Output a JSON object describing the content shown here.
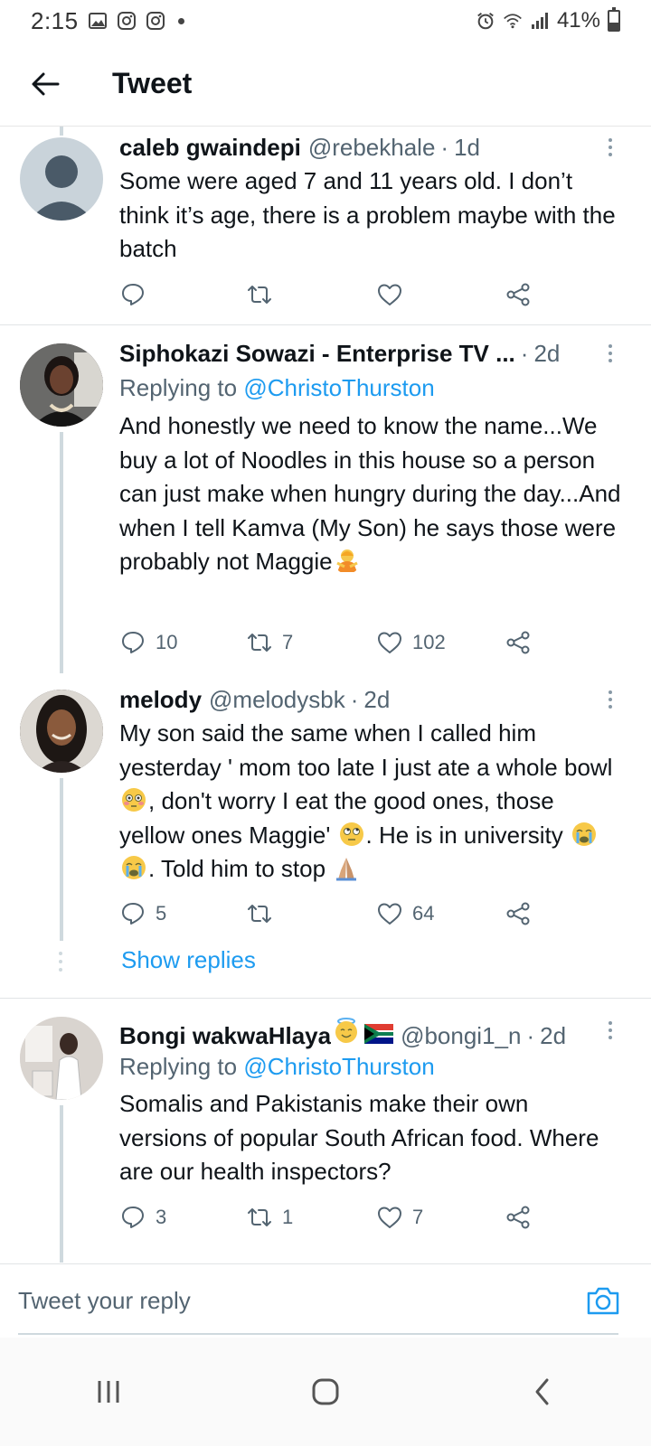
{
  "status_bar": {
    "time": "2:15",
    "battery": "41%",
    "battery_level": 0.41
  },
  "header": {
    "title": "Tweet"
  },
  "tweets": [
    {
      "name": "caleb gwaindepi",
      "handle": "@rebekhale",
      "time": "1d",
      "replying_prefix": "",
      "replying_to": "",
      "body": "Some were aged 7 and 11 years old. I don’t think it’s age, there is a problem maybe with the batch",
      "replies": "",
      "retweets": "",
      "likes": ""
    },
    {
      "name": "Siphokazi Sowazi - Enterprise TV ...",
      "handle": "",
      "time": "2d",
      "replying_prefix": "Replying to",
      "replying_to": "@ChristoThurston",
      "body_parts": [
        "And honestly we need to know the name...We buy a lot of Noodles in this house so a person can just make when hungry during the day...And when I tell Kamva (My Son) he says those were probably not Maggie"
      ],
      "replies": "10",
      "retweets": "7",
      "likes": "102"
    },
    {
      "name": "melody",
      "handle": "@melodysbk",
      "time": "2d",
      "body_parts": [
        "My son said the same when I called him yesterday ' mom too late  I just ate a whole bowl ",
        ", don't worry I eat the good ones, those yellow ones Maggie' ",
        ". He is in university ",
        ". Told him to stop "
      ],
      "replies": "5",
      "retweets": "",
      "likes": "64"
    },
    {
      "name": "Bongi wakwaHlaya",
      "handle": "@bongi1_n",
      "time": "2d",
      "replying_prefix": "Replying to",
      "replying_to": "@ChristoThurston",
      "body": "Somalis and Pakistanis make their own versions of popular South African food. Where are our health inspectors?",
      "replies": "3",
      "retweets": "1",
      "likes": "7"
    }
  ],
  "show_replies": "Show replies",
  "reply_bar": {
    "placeholder": "Tweet your reply"
  },
  "colors": {
    "accent": "#1d9bf0",
    "text": "#0f1419",
    "muted": "#536471"
  }
}
